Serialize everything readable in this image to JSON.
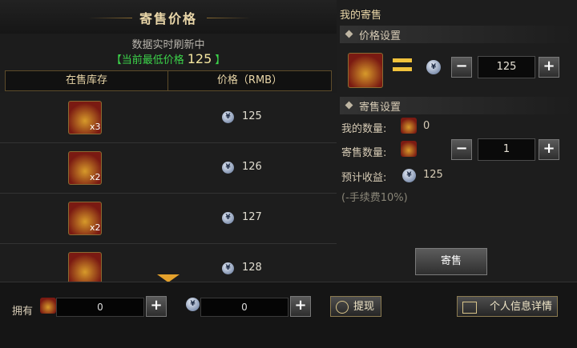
{
  "left": {
    "title": "寄售价格",
    "refresh_text": "数据实时刷新中",
    "lowest_prefix": "【当前最低价格",
    "lowest_price": "125",
    "lowest_suffix": "】",
    "col_stock": "在售库存",
    "col_price": "价格（RMB）",
    "rows": [
      {
        "qty": "x3",
        "price": "125"
      },
      {
        "qty": "x2",
        "price": "126"
      },
      {
        "qty": "x2",
        "price": "127"
      },
      {
        "qty": "",
        "price": "128"
      }
    ]
  },
  "right": {
    "title": "我的寄售",
    "price_section": "价格设置",
    "price_value": "125",
    "sale_section": "寄售设置",
    "my_qty_label": "我的数量:",
    "my_qty": "0",
    "sell_qty_label": "寄售数量:",
    "sell_qty": "1",
    "income_label": "预计收益:",
    "income": "125",
    "fee_note": "(-手续费10%)",
    "sell_button": "寄售"
  },
  "bottom": {
    "own_label": "拥有",
    "items_owned": "0",
    "coins_owned": "0",
    "withdraw_button": "提现",
    "info_button": "个人信息详情"
  },
  "icons": {
    "currency": "yuan-coin-icon",
    "item": "lucky-bag-icon"
  }
}
